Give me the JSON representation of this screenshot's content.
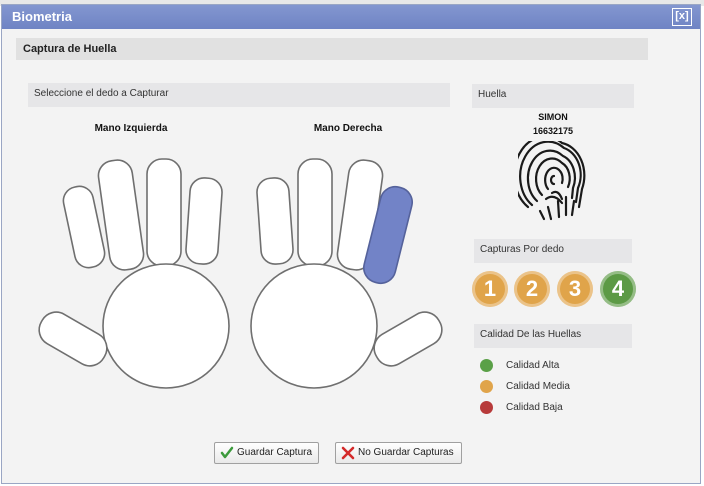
{
  "dialog": {
    "title": "Biometria",
    "close_label": "[x]"
  },
  "section": {
    "title": "Captura de Huella"
  },
  "finger_panel": {
    "instruction": "Seleccione el dedo a Capturar",
    "left_hand_label": "Mano Izquierda",
    "right_hand_label": "Mano Derecha",
    "selected_finger": "right-ring",
    "selected_color": "#7283c7"
  },
  "print_panel": {
    "label": "Huella",
    "person_name": "SIMON",
    "person_id": "16632175",
    "image_icon": "fingerprint-icon"
  },
  "captures": {
    "label": "Capturas Por dedo",
    "items": [
      {
        "number": "1",
        "color": "#e0a44a"
      },
      {
        "number": "2",
        "color": "#e0a44a"
      },
      {
        "number": "3",
        "color": "#e0a44a"
      },
      {
        "number": "4",
        "color": "#5c9a45"
      }
    ]
  },
  "quality": {
    "label": "Calidad De las Huellas",
    "levels": [
      {
        "text": "Calidad Alta",
        "color": "#5aa047"
      },
      {
        "text": "Calidad Media",
        "color": "#e0a44a"
      },
      {
        "text": "Calidad Baja",
        "color": "#b73a3a"
      }
    ]
  },
  "buttons": {
    "save": {
      "label": "Guardar Captura",
      "icon": "check-icon"
    },
    "no_save": {
      "label": "No Guardar Capturas",
      "icon": "x-mark-icon"
    }
  }
}
